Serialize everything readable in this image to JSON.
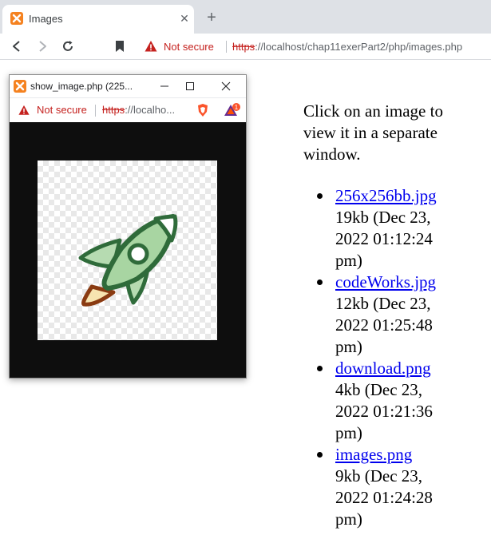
{
  "tab": {
    "title": "Images",
    "close": "✕",
    "new_tab": "+"
  },
  "toolbar": {
    "security_label": "Not secure",
    "url_scheme": "https",
    "url_rest": "://localhost/chap11exerPart2/php/images.php"
  },
  "popup": {
    "title": "show_image.php (225...",
    "security_label": "Not secure",
    "url_scheme": "https",
    "url_rest": "://localho...",
    "rewards_badge": "1",
    "image_icon": "rocket-icon"
  },
  "page": {
    "intro": "Click on an image to view it in a separate window.",
    "files": [
      {
        "name": "256x256bb.jpg",
        "meta": "19kb (Dec 23, 2022 01:12:24 pm)"
      },
      {
        "name": "codeWorks.jpg",
        "meta": "12kb (Dec 23, 2022 01:25:48 pm)"
      },
      {
        "name": "download.png",
        "meta": "4kb (Dec 23, 2022 01:21:36 pm)"
      },
      {
        "name": "images.png",
        "meta": "9kb (Dec 23, 2022 01:24:28 pm)"
      }
    ]
  },
  "colors": {
    "warning": "#c5221f",
    "link": "#0000ee",
    "xampp_orange": "#f58220",
    "rocket_green": "#2f6b3a"
  }
}
